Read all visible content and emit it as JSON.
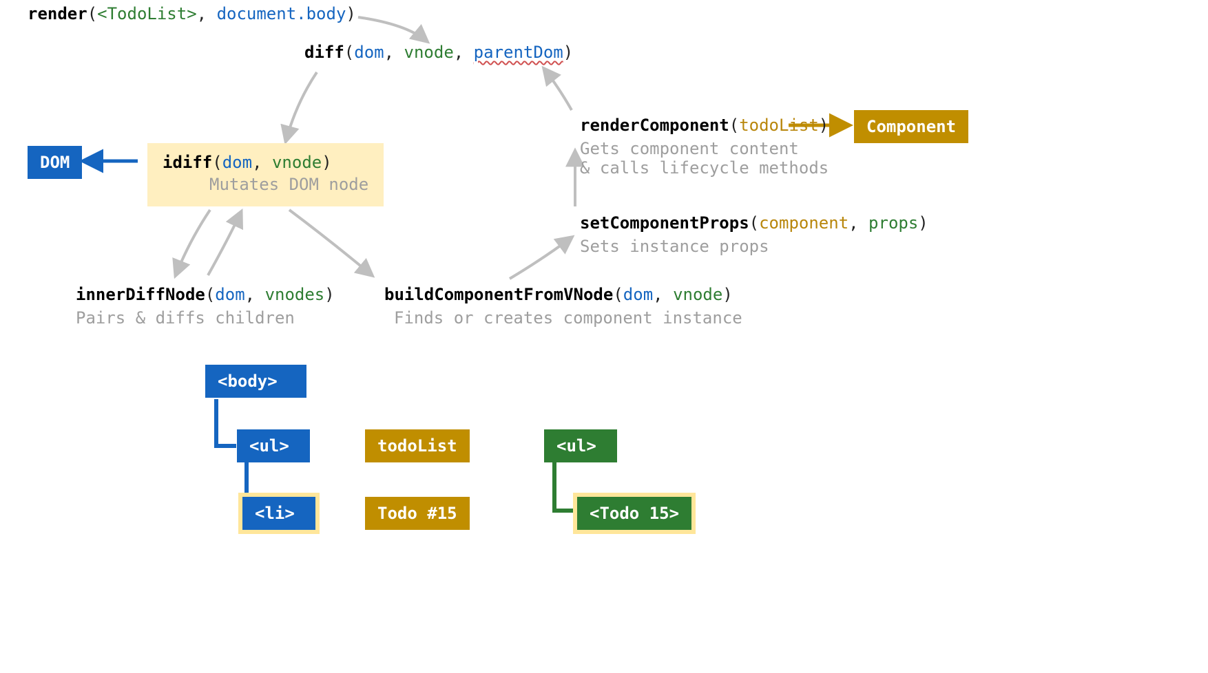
{
  "render": {
    "fn": "render",
    "arg1": "<TodoList>",
    "arg2": "document.body"
  },
  "diff": {
    "fn": "diff",
    "arg1": "dom",
    "arg2": "vnode",
    "arg3": "parentDom"
  },
  "idiff": {
    "fn": "idiff",
    "arg1": "dom",
    "arg2": "vnode",
    "desc": "Mutates DOM node"
  },
  "dom_box": "DOM",
  "innerDiffNode": {
    "fn": "innerDiffNode",
    "arg1": "dom",
    "arg2": "vnodes",
    "desc": "Pairs & diffs children"
  },
  "buildComponentFromVNode": {
    "fn": "buildComponentFromVNode",
    "arg1": "dom",
    "arg2": "vnode",
    "desc": "Finds or creates component instance"
  },
  "setComponentProps": {
    "fn": "setComponentProps",
    "arg1": "component",
    "arg2": "props",
    "desc": "Sets instance props"
  },
  "renderComponent": {
    "fn": "renderComponent",
    "arg1": "todoList",
    "desc1": "Gets component content",
    "desc2": "& calls lifecycle methods"
  },
  "component_box": "Component",
  "tree": {
    "body": "<body>",
    "ul": "<ul>",
    "li": "<li>",
    "todoList": "todoList",
    "todo15": "Todo #15",
    "ul2": "<ul>",
    "todo15tag": "<Todo 15>"
  },
  "colors": {
    "blue": "#1565c0",
    "green": "#2e7d32",
    "ochre": "#c08e00",
    "gray": "#9e9e9e",
    "highlight": "#ffefc0"
  }
}
